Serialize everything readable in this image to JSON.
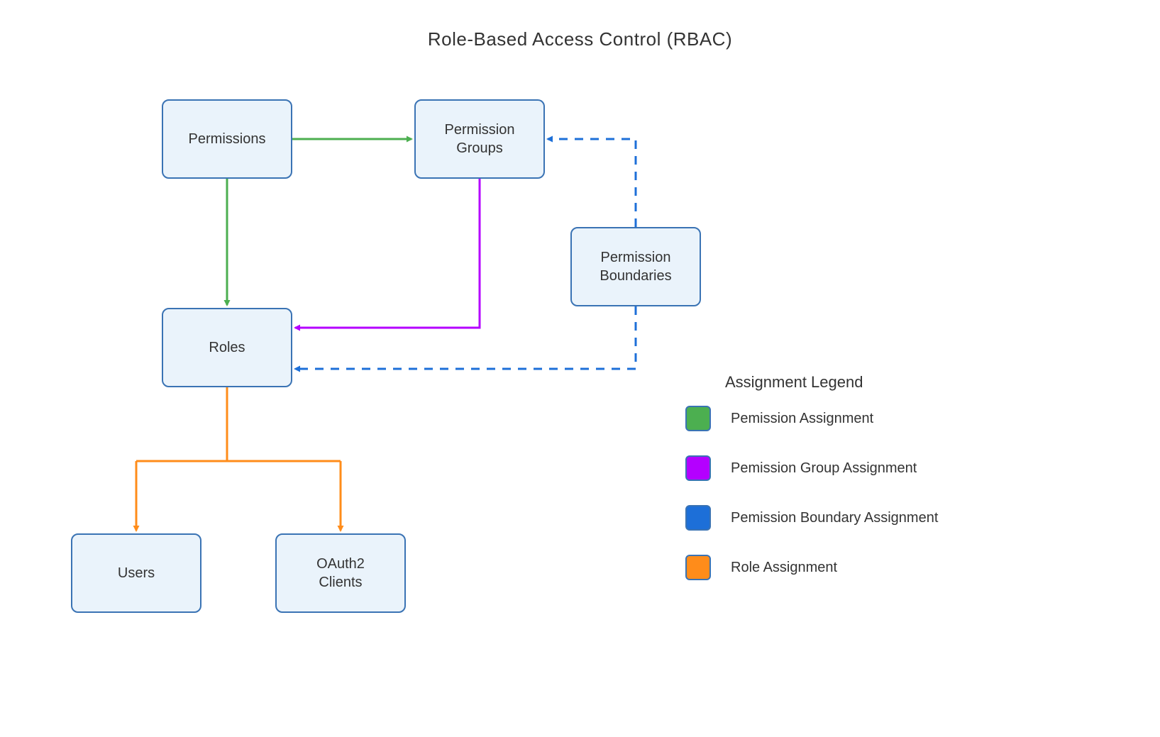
{
  "title": "Role-Based Access Control (RBAC)",
  "nodes": {
    "permissions": "Permissions",
    "permission_groups": "Permission\nGroups",
    "permission_boundaries": "Permission\nBoundaries",
    "roles": "Roles",
    "users": "Users",
    "oauth2_clients": "OAuth2\nClients"
  },
  "legend": {
    "title": "Assignment Legend",
    "items": [
      {
        "label": "Pemission Assignment",
        "fill": "#4caf50"
      },
      {
        "label": "Pemission Group Assignment",
        "fill": "#b400ff"
      },
      {
        "label": "Pemission Boundary Assignment",
        "fill": "#1d6fd8"
      },
      {
        "label": "Role Assignment",
        "fill": "#ff8c1a"
      }
    ]
  },
  "colors": {
    "green": "#4caf50",
    "purple": "#b400ff",
    "blue": "#1d6fd8",
    "orange": "#ff8c1a",
    "nodeBorder": "#3a73b4",
    "nodeFill": "#eaf3fb"
  },
  "edges": [
    {
      "from": "permissions",
      "to": "permission_groups",
      "color": "green",
      "style": "solid"
    },
    {
      "from": "permissions",
      "to": "roles",
      "color": "green",
      "style": "solid"
    },
    {
      "from": "permission_groups",
      "to": "roles",
      "color": "purple",
      "style": "solid"
    },
    {
      "from": "permission_boundaries",
      "to": "permission_groups",
      "color": "blue",
      "style": "dashed"
    },
    {
      "from": "permission_boundaries",
      "to": "roles",
      "color": "blue",
      "style": "dashed"
    },
    {
      "from": "roles",
      "to": "users",
      "color": "orange",
      "style": "solid"
    },
    {
      "from": "roles",
      "to": "oauth2_clients",
      "color": "orange",
      "style": "solid"
    }
  ]
}
